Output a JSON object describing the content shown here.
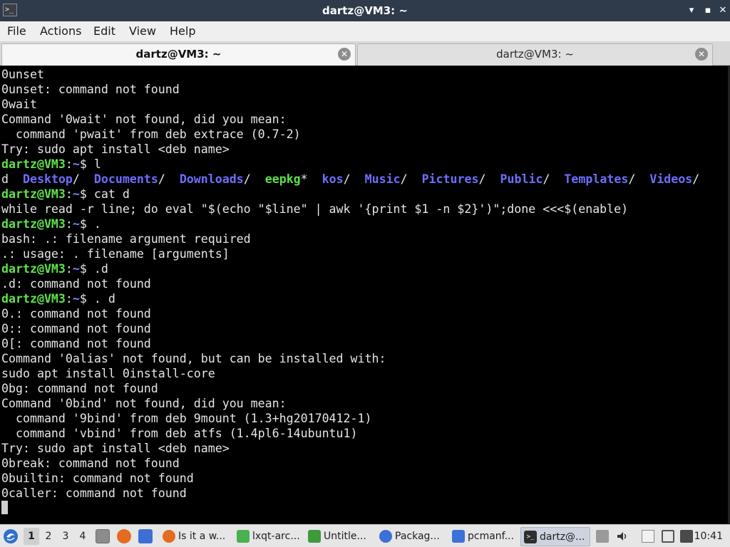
{
  "window": {
    "title": "dartz@VM3: ~",
    "minimize_glyph": "▾",
    "maximize_glyph": "▪",
    "close_glyph": "✕"
  },
  "menu": [
    "File",
    "Actions",
    "Edit",
    "View",
    "Help"
  ],
  "tabs": [
    {
      "label": "dartz@VM3: ~",
      "active": true
    },
    {
      "label": "dartz@VM3: ~",
      "active": false
    }
  ],
  "terminal": {
    "lines": [
      [
        {
          "t": "0unset"
        }
      ],
      [
        {
          "t": "0unset: command not found"
        }
      ],
      [
        {
          "t": "0wait"
        }
      ],
      [
        {
          "t": "Command '0wait' not found, did you mean:"
        }
      ],
      [
        {
          "t": "  command 'pwait' from deb extrace (0.7-2)"
        }
      ],
      [
        {
          "t": "Try: sudo apt install <deb name>"
        }
      ],
      [
        {
          "t": "dartz@VM3",
          "c": "p-user"
        },
        {
          "t": ":"
        },
        {
          "t": "~",
          "c": "p-path"
        },
        {
          "t": "$ l"
        }
      ],
      [
        {
          "t": "d  "
        },
        {
          "t": "Desktop",
          "c": "dir"
        },
        {
          "t": "/  "
        },
        {
          "t": "Documents",
          "c": "dir"
        },
        {
          "t": "/  "
        },
        {
          "t": "Downloads",
          "c": "dir"
        },
        {
          "t": "/  "
        },
        {
          "t": "eepkg",
          "c": "exe"
        },
        {
          "t": "*  "
        },
        {
          "t": "kos",
          "c": "dir"
        },
        {
          "t": "/  "
        },
        {
          "t": "Music",
          "c": "dir"
        },
        {
          "t": "/  "
        },
        {
          "t": "Pictures",
          "c": "dir"
        },
        {
          "t": "/  "
        },
        {
          "t": "Public",
          "c": "dir"
        },
        {
          "t": "/  "
        },
        {
          "t": "Templates",
          "c": "dir"
        },
        {
          "t": "/  "
        },
        {
          "t": "Videos",
          "c": "dir"
        },
        {
          "t": "/"
        }
      ],
      [
        {
          "t": "dartz@VM3",
          "c": "p-user"
        },
        {
          "t": ":"
        },
        {
          "t": "~",
          "c": "p-path"
        },
        {
          "t": "$ cat d"
        }
      ],
      [
        {
          "t": "while read -r line; do eval \"$(echo \"$line\" | awk '{print $1 -n $2}')\";done <<<$(enable)"
        }
      ],
      [
        {
          "t": "dartz@VM3",
          "c": "p-user"
        },
        {
          "t": ":"
        },
        {
          "t": "~",
          "c": "p-path"
        },
        {
          "t": "$ ."
        }
      ],
      [
        {
          "t": "bash: .: filename argument required"
        }
      ],
      [
        {
          "t": ".: usage: . filename [arguments]"
        }
      ],
      [
        {
          "t": "dartz@VM3",
          "c": "p-user"
        },
        {
          "t": ":"
        },
        {
          "t": "~",
          "c": "p-path"
        },
        {
          "t": "$ .d"
        }
      ],
      [
        {
          "t": ".d: command not found"
        }
      ],
      [
        {
          "t": "dartz@VM3",
          "c": "p-user"
        },
        {
          "t": ":"
        },
        {
          "t": "~",
          "c": "p-path"
        },
        {
          "t": "$ . d"
        }
      ],
      [
        {
          "t": "0.: command not found"
        }
      ],
      [
        {
          "t": "0:: command not found"
        }
      ],
      [
        {
          "t": "0[: command not found"
        }
      ],
      [
        {
          "t": "Command '0alias' not found, but can be installed with:"
        }
      ],
      [
        {
          "t": "sudo apt install 0install-core"
        }
      ],
      [
        {
          "t": "0bg: command not found"
        }
      ],
      [
        {
          "t": "Command '0bind' not found, did you mean:"
        }
      ],
      [
        {
          "t": "  command '9bind' from deb 9mount (1.3+hg20170412-1)"
        }
      ],
      [
        {
          "t": "  command 'vbind' from deb atfs (1.4pl6-14ubuntu1)"
        }
      ],
      [
        {
          "t": "Try: sudo apt install <deb name>"
        }
      ],
      [
        {
          "t": "0break: command not found"
        }
      ],
      [
        {
          "t": "0builtin: command not found"
        }
      ],
      [
        {
          "t": "0caller: command not found"
        }
      ]
    ]
  },
  "taskbar": {
    "desktops": [
      "1",
      "2",
      "3",
      "4"
    ],
    "current_desktop": "1",
    "quicklaunch_icons": [
      "file-manager-icon",
      "firefox-icon",
      "show-desktop-icon"
    ],
    "tasks": [
      {
        "label": "Is it a w...",
        "icon": "firefox-icon",
        "color": "#e66a1f",
        "active": false
      },
      {
        "label": "lxqt-arc...",
        "icon": "archiver-icon",
        "color": "#4caf50",
        "active": false
      },
      {
        "label": "Untitle...",
        "icon": "spreadsheet-icon",
        "color": "#3f9a3a",
        "active": false
      },
      {
        "label": "Packag...",
        "icon": "package-manager-icon",
        "color": "#3d6fd6",
        "active": false
      },
      {
        "label": "pcmanf...",
        "icon": "folder-icon",
        "color": "#3b72d9",
        "active": false
      },
      {
        "label": "dartz@...",
        "icon": "terminal-icon",
        "color": "#2f2f2f",
        "active": true
      }
    ],
    "tray_icons": [
      "volume-icon",
      "clipboard-icon",
      "network-icon",
      "update-icon"
    ],
    "clock": "10:41"
  },
  "colors": {
    "titlebar": "#2f3a4a",
    "prompt_user": "#5fe14a",
    "prompt_path": "#6f8cff",
    "directory": "#6e6eff",
    "executable": "#5fe14a",
    "terminal_bg": "#000000"
  }
}
